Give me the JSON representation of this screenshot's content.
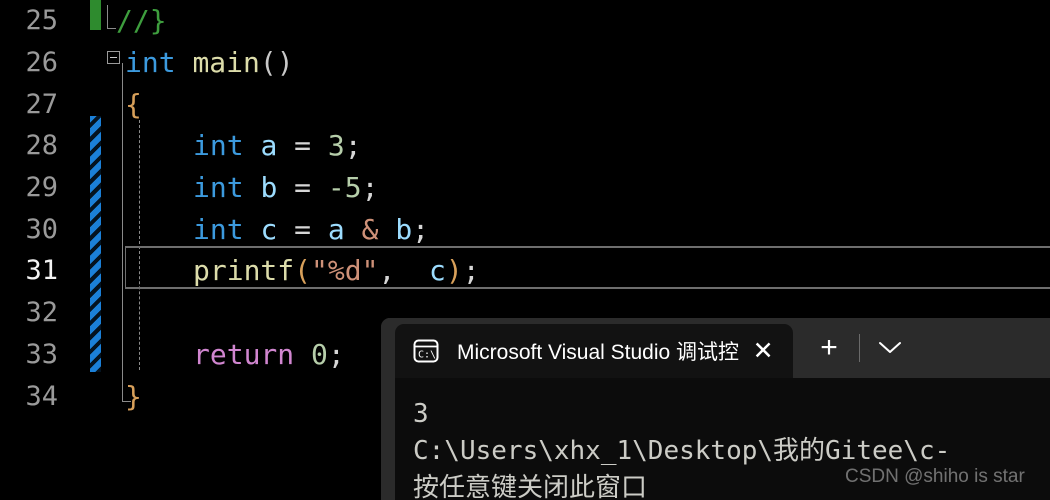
{
  "editor": {
    "gutter": {
      "saved_marker_color": "#2e8b2e",
      "unsaved_marker_color": "#1b80d8"
    },
    "current_line": 31,
    "lines": [
      {
        "number": "25",
        "tokens": [
          {
            "t": "//}",
            "c": "tok-comment"
          }
        ]
      },
      {
        "number": "26",
        "tokens": [
          {
            "t": "int",
            "c": "tok-keyword"
          },
          {
            "t": " ",
            "c": "tok-plain"
          },
          {
            "t": "main",
            "c": "tok-func"
          },
          {
            "t": "()",
            "c": "tok-brace2"
          }
        ]
      },
      {
        "number": "27",
        "tokens": [
          {
            "t": "{",
            "c": "tok-brace1"
          }
        ]
      },
      {
        "number": "28",
        "tokens": [
          {
            "t": "int",
            "c": "tok-keyword"
          },
          {
            "t": " ",
            "c": "tok-plain"
          },
          {
            "t": "a",
            "c": "tok-var"
          },
          {
            "t": " = ",
            "c": "tok-op"
          },
          {
            "t": "3",
            "c": "tok-num"
          },
          {
            "t": ";",
            "c": "tok-punct"
          }
        ]
      },
      {
        "number": "29",
        "tokens": [
          {
            "t": "int",
            "c": "tok-keyword"
          },
          {
            "t": " ",
            "c": "tok-plain"
          },
          {
            "t": "b",
            "c": "tok-var"
          },
          {
            "t": " = ",
            "c": "tok-op"
          },
          {
            "t": "-5",
            "c": "tok-num"
          },
          {
            "t": ";",
            "c": "tok-punct"
          }
        ]
      },
      {
        "number": "30",
        "tokens": [
          {
            "t": "int",
            "c": "tok-keyword"
          },
          {
            "t": " ",
            "c": "tok-plain"
          },
          {
            "t": "c",
            "c": "tok-var"
          },
          {
            "t": " = ",
            "c": "tok-op"
          },
          {
            "t": "a",
            "c": "tok-var"
          },
          {
            "t": " ",
            "c": "tok-plain"
          },
          {
            "t": "&",
            "c": "tok-str"
          },
          {
            "t": " ",
            "c": "tok-plain"
          },
          {
            "t": "b",
            "c": "tok-var"
          },
          {
            "t": ";",
            "c": "tok-punct"
          }
        ]
      },
      {
        "number": "31",
        "tokens": [
          {
            "t": "printf",
            "c": "tok-func"
          },
          {
            "t": "(",
            "c": "tok-brace1"
          },
          {
            "t": "\"%d\"",
            "c": "tok-str"
          },
          {
            "t": ", ",
            "c": "tok-punct"
          },
          {
            "t": " c",
            "c": "tok-var"
          },
          {
            "t": ")",
            "c": "tok-brace1"
          },
          {
            "t": ";",
            "c": "tok-punct"
          }
        ]
      },
      {
        "number": "32",
        "tokens": []
      },
      {
        "number": "33",
        "tokens": [
          {
            "t": "return",
            "c": "tok-ctrl"
          },
          {
            "t": " ",
            "c": "tok-plain"
          },
          {
            "t": "0",
            "c": "tok-num"
          },
          {
            "t": ";",
            "c": "tok-punct"
          }
        ]
      },
      {
        "number": "34",
        "tokens": [
          {
            "t": "}",
            "c": "tok-brace1"
          }
        ]
      }
    ]
  },
  "terminal": {
    "tab": {
      "icon": "console-cmd-icon",
      "title": "Microsoft Visual Studio 调试控",
      "close_label": "✕"
    },
    "newtab_label": "+",
    "dropdown_label": "chevron-down-icon",
    "output_lines": [
      "3",
      "C:\\Users\\xhx_1\\Desktop\\我的Gitee\\c-",
      "按任意键关闭此窗口"
    ]
  },
  "watermark": "CSDN @shiho is star"
}
